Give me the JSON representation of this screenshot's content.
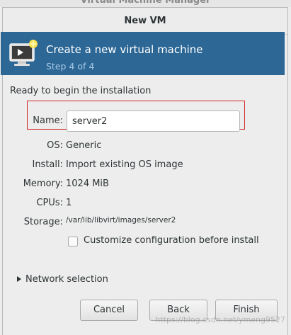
{
  "parent_window": {
    "title": "Virtual Machine Manager"
  },
  "dialog": {
    "title": "New VM",
    "banner": {
      "title": "Create a new virtual machine",
      "step": "Step 4 of 4"
    },
    "ready_text": "Ready to begin the installation",
    "fields": {
      "name_label": "Name:",
      "name_value": "server2",
      "os_label": "OS:",
      "os_value": "Generic",
      "install_label": "Install:",
      "install_value": "Import existing OS image",
      "memory_label": "Memory:",
      "memory_value": "1024 MiB",
      "cpus_label": "CPUs:",
      "cpus_value": "1",
      "storage_label": "Storage:",
      "storage_value": "/var/lib/libvirt/images/server2"
    },
    "customize_checkbox": {
      "label": "Customize configuration before install",
      "checked": false
    },
    "network_expander": {
      "label": "Network selection"
    },
    "buttons": {
      "cancel": "Cancel",
      "back": "Back",
      "finish": "Finish"
    }
  },
  "watermark": "https://blog.csdn.net/ymeng9527",
  "colors": {
    "banner_bg": "#2c6795",
    "highlight_border": "#cc2b2b"
  },
  "icons": {
    "banner": "monitor-new-icon",
    "expander": "triangle-right-icon"
  }
}
